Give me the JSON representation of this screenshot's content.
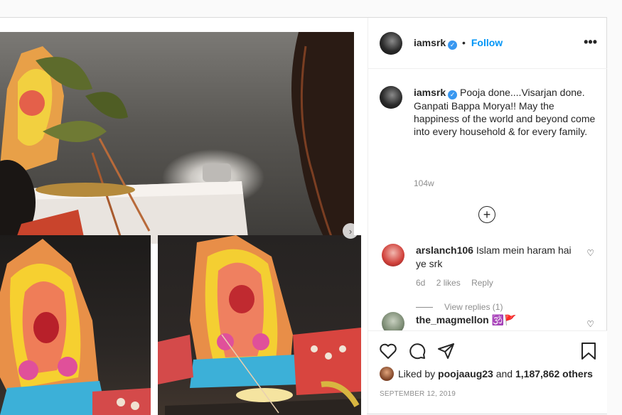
{
  "post": {
    "username": "iamsrk",
    "follow_label": "Follow",
    "dot": "•",
    "more_label": "•••",
    "caption": "Pooja done....Visarjan done. Ganpati Bappa Morya!! May the happiness of the world and beyond come into every household & for every family.",
    "caption_time": "104w",
    "load_more_label": "+"
  },
  "comments": [
    {
      "username": "arslanch106",
      "text": "Islam mein haram hai ye srk",
      "time": "6d",
      "likes": "2 likes",
      "reply_label": "Reply",
      "view_replies": "View replies (1)"
    },
    {
      "username": "the_magmellon",
      "text": "🕉️🚩"
    }
  ],
  "footer": {
    "liked_by_prefix": "Liked by",
    "liked_by_user": "poojaaug23",
    "liked_by_and": "and",
    "others": "1,187,862 others",
    "date": "SEPTEMBER 12, 2019"
  },
  "colors": {
    "accent": "#0095f6",
    "verified": "#3897f0",
    "muted": "#8e8e8e"
  },
  "icons": [
    "verified-badge-icon",
    "more-options-icon",
    "load-more-comments-icon",
    "heart-icon",
    "comment-icon",
    "share-icon",
    "bookmark-icon",
    "carousel-next-icon"
  ]
}
